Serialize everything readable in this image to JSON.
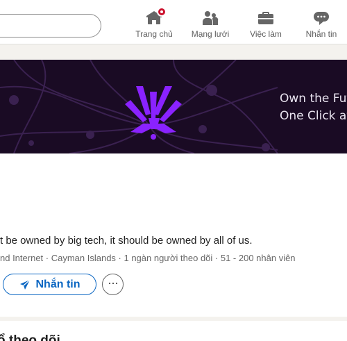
{
  "nav": {
    "items": [
      {
        "label": "Trang chủ",
        "icon": "home-icon"
      },
      {
        "label": "Mạng lưới",
        "icon": "people-icon"
      },
      {
        "label": "Việc làm",
        "icon": "briefcase-icon"
      },
      {
        "label": "Nhắn tin",
        "icon": "message-icon"
      }
    ]
  },
  "banner": {
    "line1": "Own the Fut",
    "line2": "One Click at",
    "accent_color": "#9b2cff"
  },
  "company": {
    "tagline": "t be owned by big tech, it should be owned by all of us.",
    "meta": "nd Internet · Cayman Islands · 1 ngàn người theo dõi · 51 - 200 nhân viên"
  },
  "actions": {
    "message_label": "Nhắn tin",
    "more_label": "···"
  },
  "section": {
    "title": "ổ theo dõi"
  },
  "colors": {
    "brand": "#0a66c2",
    "notification": "#cb112d"
  }
}
